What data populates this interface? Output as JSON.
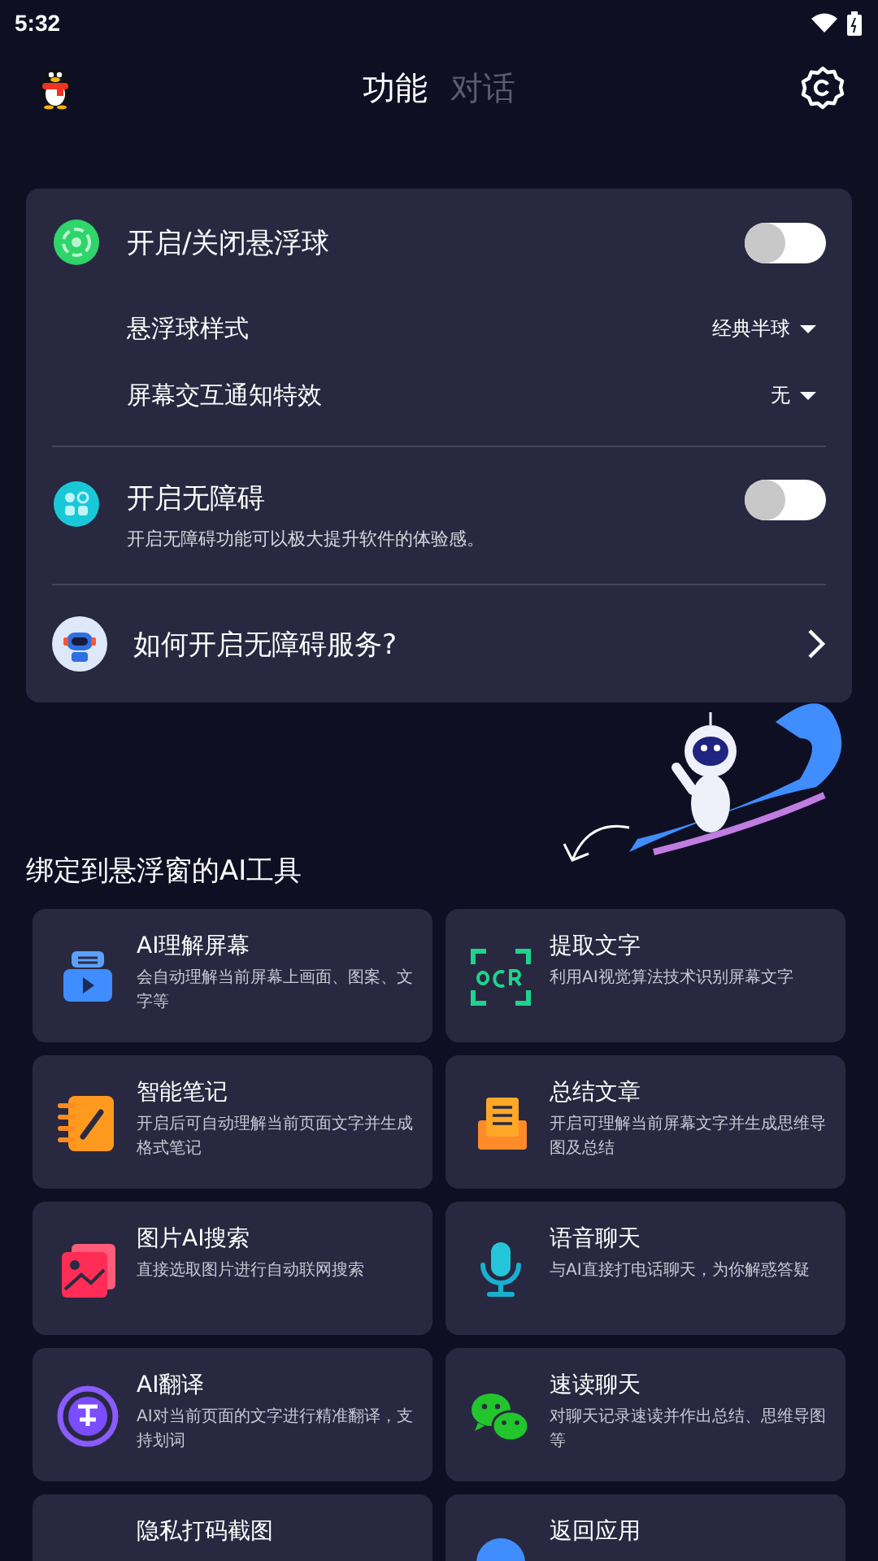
{
  "status_bar": {
    "time": "5:32"
  },
  "tabs": [
    {
      "label": "功能",
      "selected": true
    },
    {
      "label": "对话",
      "selected": false
    }
  ],
  "settings_card": {
    "floating_ball": {
      "title": "开启/关闭悬浮球",
      "on": false
    },
    "options": [
      {
        "label": "悬浮球样式",
        "value": "经典半球"
      },
      {
        "label": "屏幕交互通知特效",
        "value": "无"
      }
    ],
    "accessibility": {
      "title": "开启无障碍",
      "description": "开启无障碍功能可以极大提升软件的体验感。",
      "on": false
    },
    "help_link": "如何开启无障碍服务?"
  },
  "tools_section": {
    "title": "绑定到悬浮窗的AI工具",
    "tools": [
      {
        "title": "AI理解屏幕",
        "description": "会自动理解当前屏幕上画面、图案、文字等"
      },
      {
        "title": "提取文字",
        "description": "利用AI视觉算法技术识别屏幕文字"
      },
      {
        "title": "智能笔记",
        "description": "开启后可自动理解当前页面文字并生成格式笔记"
      },
      {
        "title": "总结文章",
        "description": "开启可理解当前屏幕文字并生成思维导图及总结"
      },
      {
        "title": "图片AI搜索",
        "description": "直接选取图片进行自动联网搜索"
      },
      {
        "title": "语音聊天",
        "description": "与AI直接打电话聊天，为你解惑答疑"
      },
      {
        "title": "AI翻译",
        "description": "AI对当前页面的文字进行精准翻译，支持划词"
      },
      {
        "title": "速读聊天",
        "description": "对聊天记录速读并作出总结、思维导图等"
      },
      {
        "title": "隐私打码截图"
      },
      {
        "title": "返回应用"
      }
    ]
  }
}
